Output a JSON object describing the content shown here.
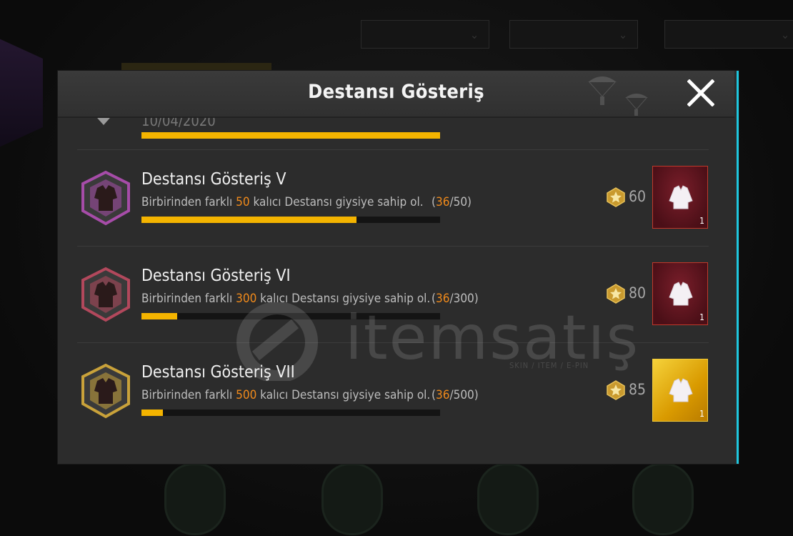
{
  "dialog": {
    "title": "Destansı Gösteriş"
  },
  "partial_row": {
    "date": "10/04/2020",
    "progress": 1.0
  },
  "achievements": [
    {
      "name": "Destansı Gösteriş V",
      "desc_before": "Birbirinden farklı ",
      "desc_target": "50",
      "desc_after": " kalıcı Destansı giysiye sahip ol.",
      "progress_open": "(",
      "progress_current": "36",
      "progress_total": "/50)",
      "progress": 0.72,
      "reward_points": "60",
      "reward_count": "1",
      "tier_color": "#a64ca8",
      "reward_style": "red"
    },
    {
      "name": "Destansı Gösteriş VI",
      "desc_before": "Birbirinden farklı ",
      "desc_target": "300",
      "desc_after": " kalıcı Destansı giysiye sahip ol.",
      "progress_open": "(",
      "progress_current": "36",
      "progress_total": "/300)",
      "progress": 0.12,
      "reward_points": "80",
      "reward_count": "1",
      "tier_color": "#b2485c",
      "reward_style": "red"
    },
    {
      "name": "Destansı Gösteriş VII",
      "desc_before": "Birbirinden farklı ",
      "desc_target": "500",
      "desc_after": " kalıcı Destansı giysiye sahip ol.",
      "progress_open": "(",
      "progress_current": "36",
      "progress_total": "/500)",
      "progress": 0.072,
      "reward_points": "85",
      "reward_count": "1",
      "tier_color": "#c9a23a",
      "reward_style": "gold"
    }
  ],
  "watermark": {
    "text": "itemsatış",
    "sub": "SKIN / ITEM / E-PIN"
  },
  "colors": {
    "progress_fill": "#f4b400",
    "highlight": "#f08a1b",
    "accent_edge": "#1fc7df"
  },
  "icons": {
    "close": "close-icon",
    "coin": "star-coin-icon",
    "reward": "jacket-icon"
  }
}
